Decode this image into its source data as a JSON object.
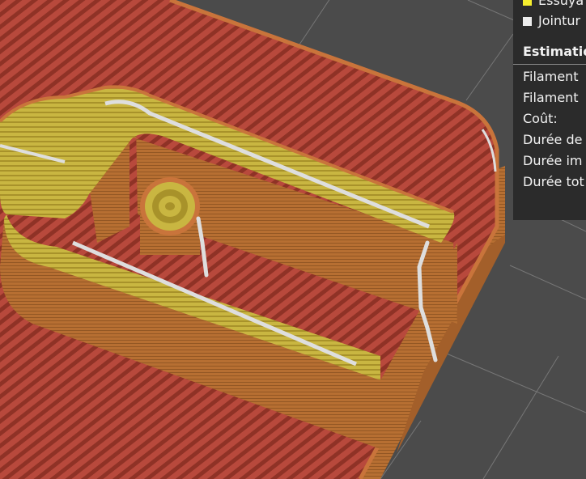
{
  "legend": {
    "items": [
      {
        "label": "Essuya",
        "color": "#f5ee2e"
      },
      {
        "label": "Jointur",
        "color": "#ececec"
      }
    ]
  },
  "estimation": {
    "title": "Estimatio",
    "rows": [
      "Filament",
      "Filament",
      "Coût:",
      "Durée de",
      "Durée im",
      "Durée tot"
    ]
  },
  "colors": {
    "background": "#4b4b4b",
    "grid_line": "#8a8a8a",
    "infill": "#b8493c",
    "perimeter_wall": "#b76f32",
    "top_perimeter": "#c9b641",
    "wipe_path": "#f5ee2e",
    "seam_path": "#dedede",
    "panel_bg": "#2b2b2b"
  }
}
